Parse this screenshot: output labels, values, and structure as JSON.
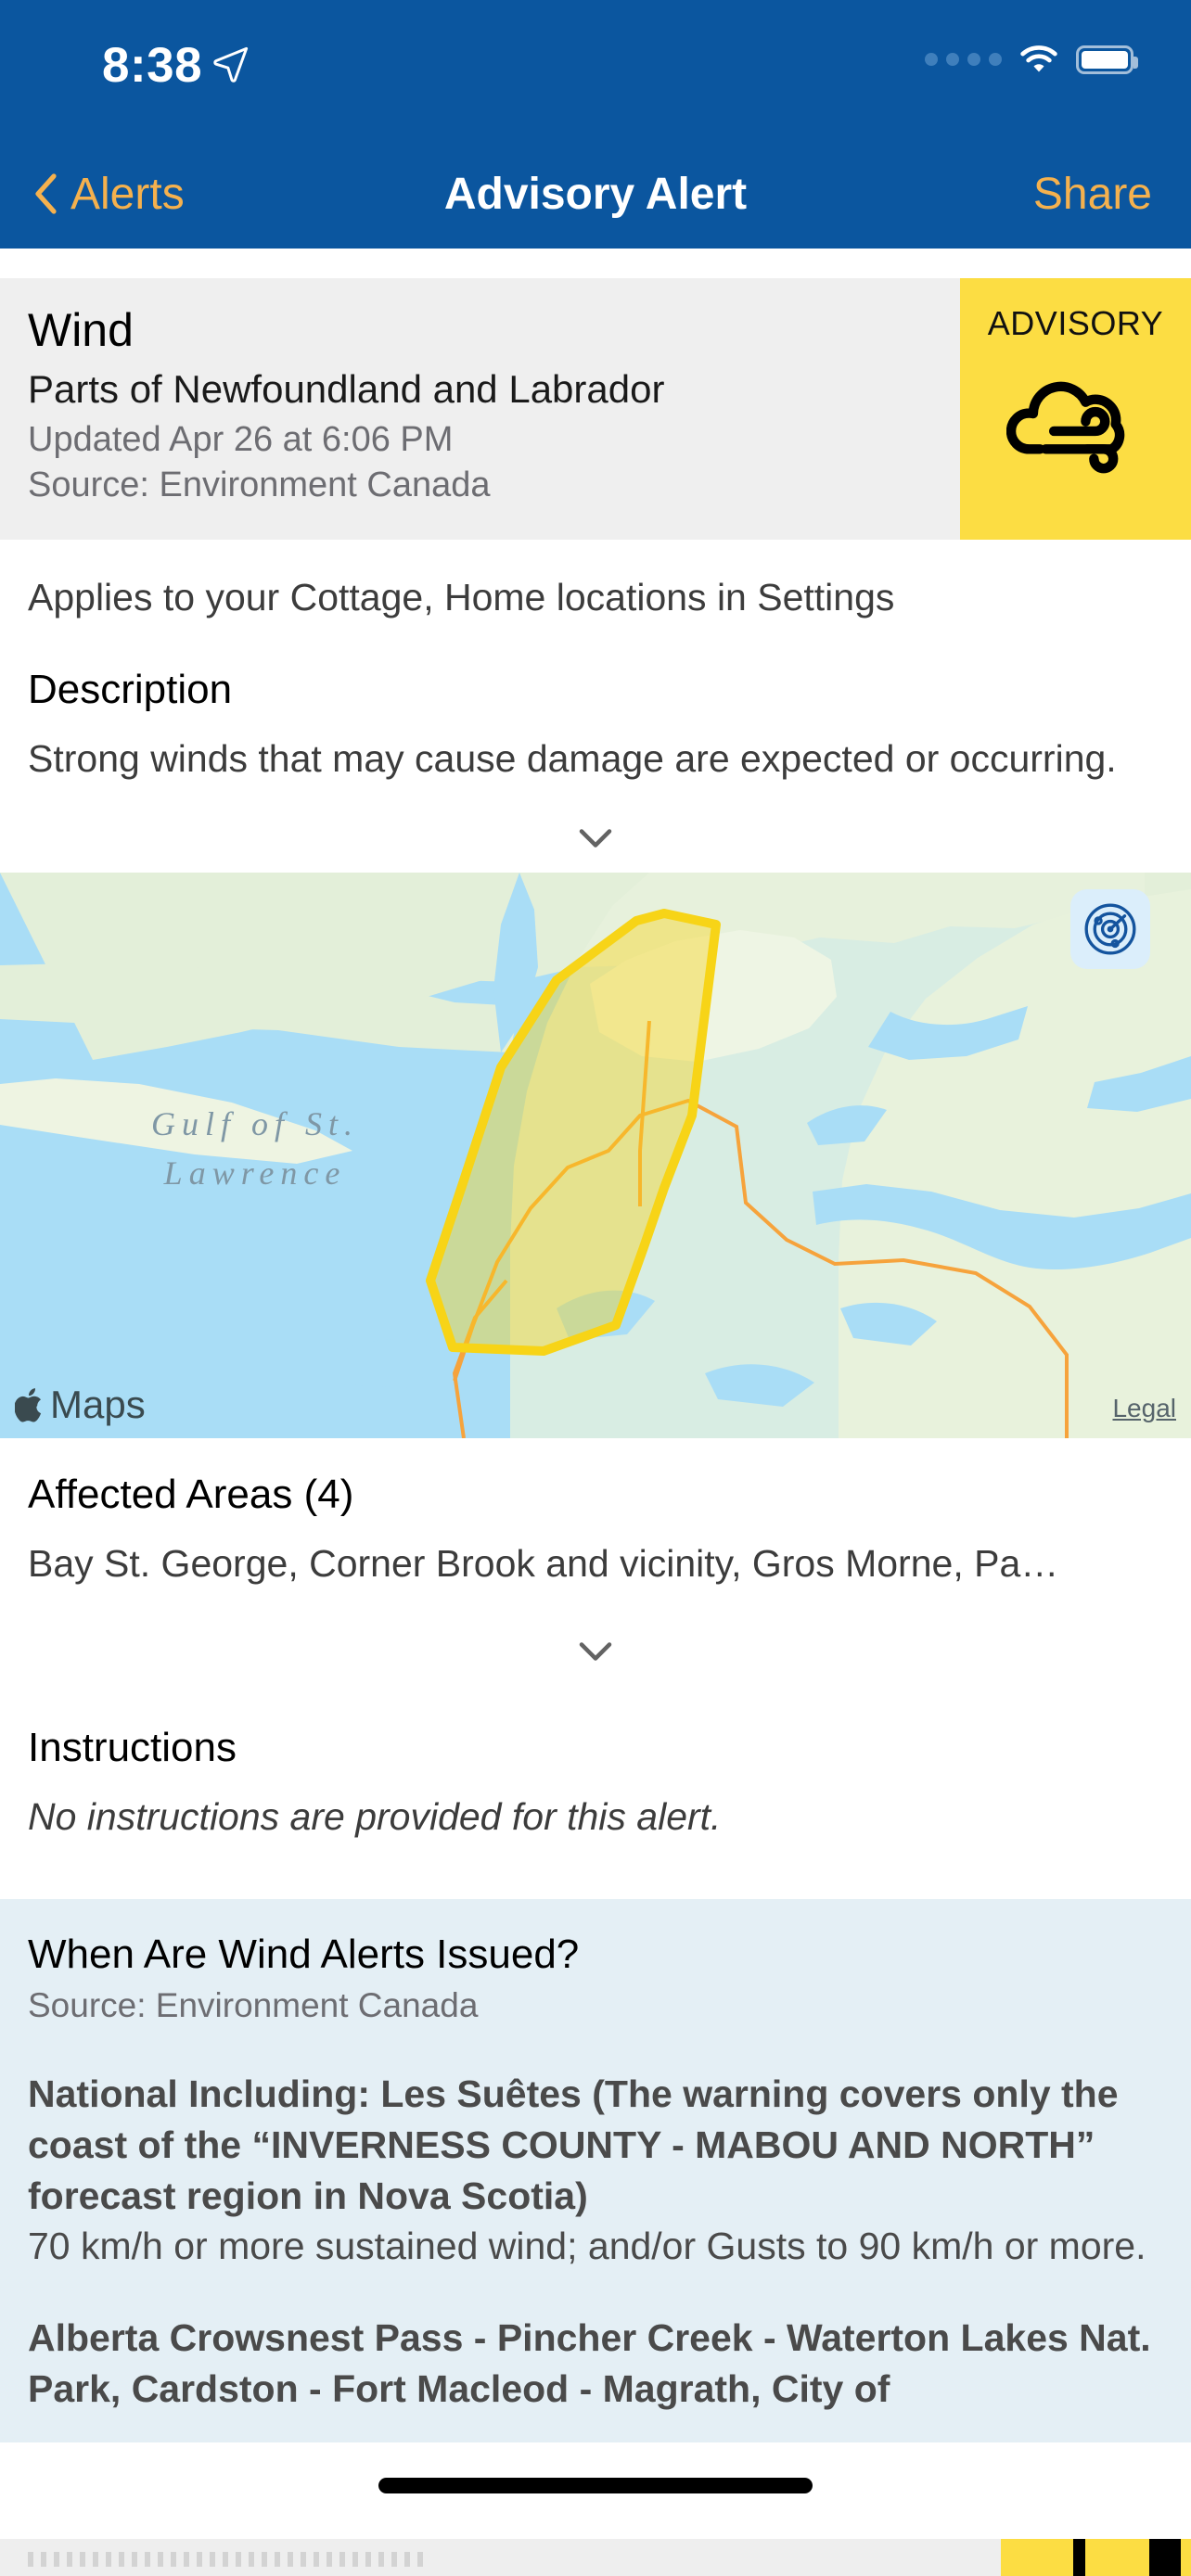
{
  "status_bar": {
    "time": "8:38",
    "location_icon": "location-arrow-icon",
    "cellular_icon": "cellular-dots-icon",
    "wifi_icon": "wifi-icon",
    "battery_icon": "battery-full-icon"
  },
  "nav_bar": {
    "back_label": "Alerts",
    "back_icon": "chevron-left-icon",
    "title": "Advisory Alert",
    "share_label": "Share"
  },
  "alert": {
    "type": "Wind",
    "region": "Parts of Newfoundland and Labrador",
    "updated": "Updated Apr 26 at 6:06 PM",
    "source": "Source: Environment Canada",
    "severity_label": "ADVISORY",
    "severity_icon": "cloud-wind-icon",
    "severity_color": "#fcdd43",
    "applies_to": "Applies to your Cottage, Home locations in Settings"
  },
  "description": {
    "title": "Description",
    "text": "Strong winds that may cause damage are expected or occurring.",
    "expand_icon": "chevron-down-icon"
  },
  "map": {
    "ocean_label": "Gulf of St. Lawrence",
    "attribution": "Maps",
    "apple_icon": "apple-logo-icon",
    "legal_link": "Legal",
    "radar_icon": "radar-icon",
    "alert_area_color": "#f7d417"
  },
  "affected_areas": {
    "title": "Affected Areas (4)",
    "text": "Bay St. George, Corner Brook and vicinity, Gros Morne, Pa…",
    "expand_icon": "chevron-down-icon"
  },
  "instructions": {
    "title": "Instructions",
    "text": "No instructions are provided for this alert."
  },
  "info_panel": {
    "title": "When Are Wind Alerts Issued?",
    "source": "Source: Environment Canada",
    "entries": [
      {
        "heading": "National Including: Les Suêtes (The warning covers only the coast of the “INVERNESS COUNTY - MABOU AND NORTH” forecast region in Nova Scotia)",
        "body": "70 km/h or more sustained wind; and/or Gusts to 90 km/h or more."
      },
      {
        "heading": "Alberta Crowsnest Pass - Pincher Creek - Waterton Lakes Nat. Park, Cardston - Fort Macleod - Magrath, City of",
        "body": ""
      }
    ]
  },
  "theme": {
    "nav_background": "#0b569f",
    "accent": "#f5b14e",
    "card_background": "#efefef",
    "info_background": "#e4eff5"
  }
}
